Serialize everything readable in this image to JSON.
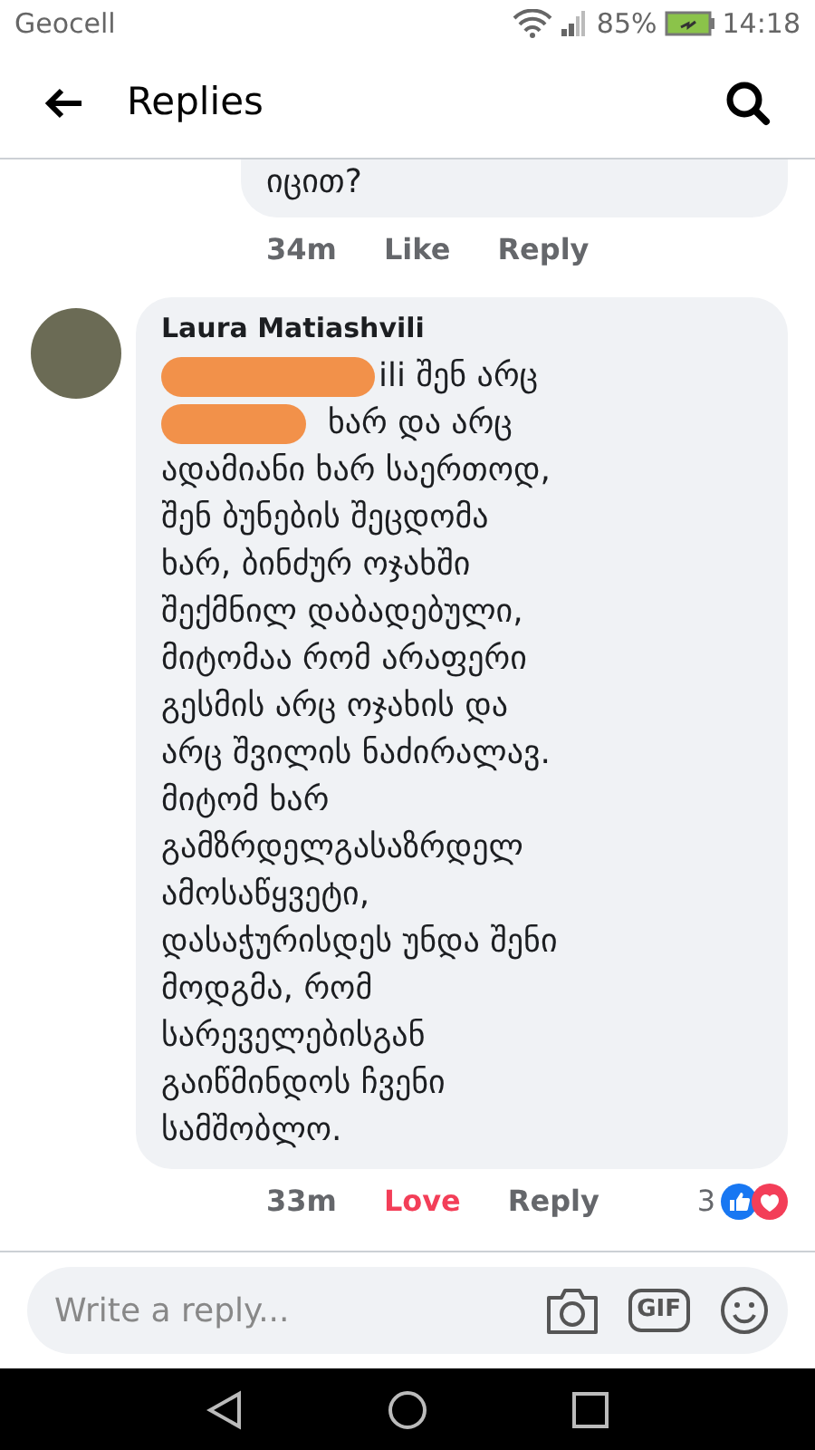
{
  "status_bar": {
    "carrier": "Geocell",
    "battery": "85%",
    "time": "14:18"
  },
  "header": {
    "title": "Replies"
  },
  "comments": [
    {
      "lines": [
        "იცით?"
      ],
      "time": "34m",
      "reaction": {
        "label": "Like",
        "reacted": false
      },
      "reply": "Reply"
    },
    {
      "author": "Laura Matiashvili",
      "redacted_lines": [
        "ili შენ არც",
        "ხარ და არც"
      ],
      "lines": [
        "ადამიანი ხარ საერთოდ,",
        "შენ ბუნების შეცდომა",
        "ხარ, ბინძურ ოჯახში",
        "შექმნილ დაბადებული,",
        "მიტომაა რომ არაფერი",
        "გესმის არც ოჯახის და",
        "არც შვილის ნაძირალავ.",
        "მიტომ ხარ",
        "გამზრდელგასაზრდელ",
        "ამოსაწყვეტი,",
        "დასაჭურისდეს უნდა შენი",
        "მოდგმა, რომ",
        "სარეველებისგან",
        "გაიწმინდოს ჩვენი",
        "სამშობლო."
      ],
      "time": "33m",
      "reaction": {
        "label": "Love",
        "reacted": true
      },
      "reply": "Reply",
      "reaction_count": "3"
    }
  ],
  "composer": {
    "placeholder": "Write a reply...",
    "gif_label": "GIF"
  }
}
